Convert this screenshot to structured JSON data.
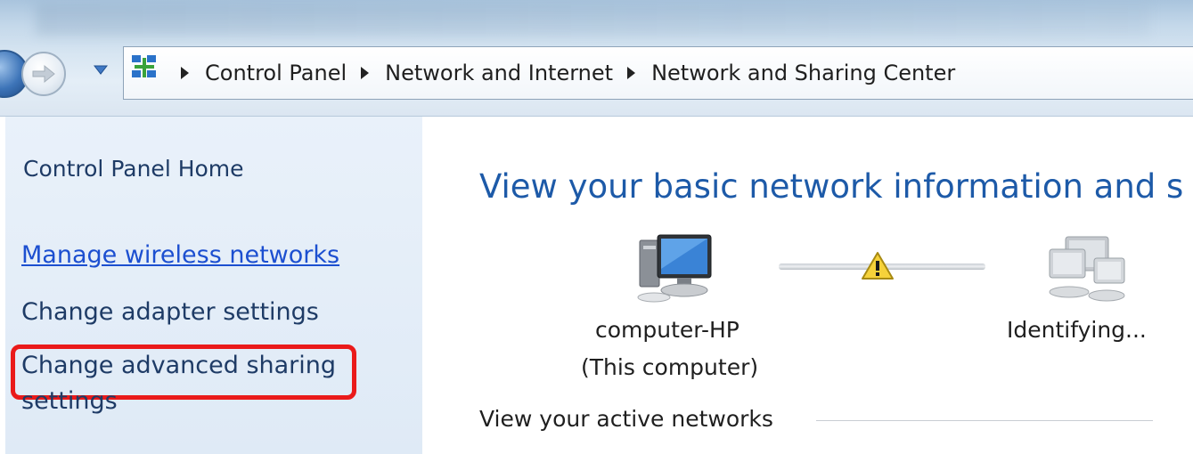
{
  "address_bar": {
    "breadcrumbs": [
      "Control Panel",
      "Network and Internet",
      "Network and Sharing Center"
    ]
  },
  "sidebar": {
    "home_label": "Control Panel Home",
    "links": [
      {
        "label": "Manage wireless networks",
        "highlighted": true
      },
      {
        "label": "Change adapter settings"
      },
      {
        "label": "Change advanced sharing"
      },
      {
        "label": "settings"
      }
    ]
  },
  "main": {
    "title": "View your basic network information and s",
    "network_map": {
      "computer_name": "computer-HP",
      "computer_sub": "(This computer)",
      "network_status": "Identifying..."
    },
    "active_networks_label": "View your active networks"
  },
  "colors": {
    "link": "#1c4fd0",
    "heading": "#1d5aa8",
    "highlight": "#ea1a1a",
    "sidebar_bg": "#e2ecf7"
  }
}
